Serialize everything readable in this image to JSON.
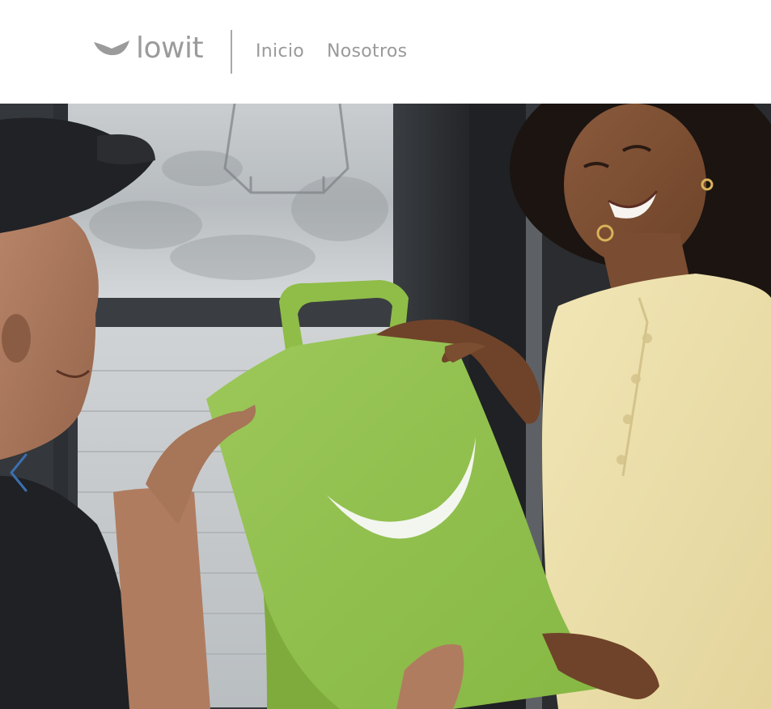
{
  "header": {
    "logo": {
      "text": "lowit",
      "icon": "smile-logo-icon"
    },
    "nav": [
      {
        "label": "Inicio"
      },
      {
        "label": "Nosotros"
      }
    ]
  },
  "hero": {
    "image_subject": "delivery-handoff-photo",
    "carousel": {
      "prev_icon": "chevron-left-icon"
    }
  },
  "colors": {
    "logo_gray": "#9b9b9b",
    "nav_gray": "#9a9a9a",
    "bag_green": "#8fc04a",
    "header_bg": "#ffffff"
  }
}
